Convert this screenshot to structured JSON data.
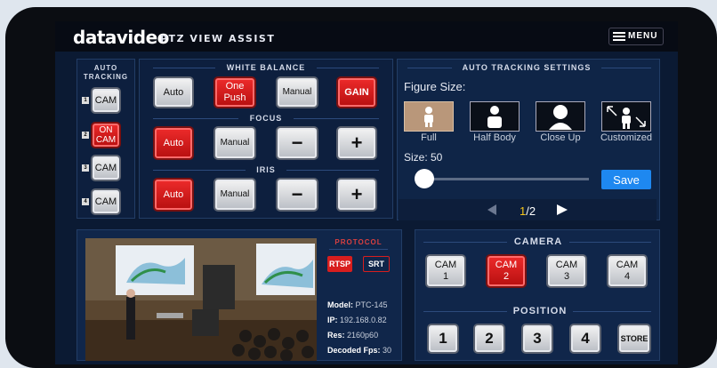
{
  "header": {
    "brand": "datavideo",
    "title": "PTZ VIEW ASSIST",
    "menu_label": "MENU"
  },
  "auto_tracking": {
    "title_line1": "AUTO",
    "title_line2": "TRACKING",
    "cams": [
      {
        "num": "1",
        "label": "CAM",
        "state": "off"
      },
      {
        "num": "2",
        "label_line1": "ON",
        "label_line2": "CAM",
        "state": "on"
      },
      {
        "num": "3",
        "label": "CAM",
        "state": "off"
      },
      {
        "num": "4",
        "label": "CAM",
        "state": "off"
      }
    ]
  },
  "white_balance": {
    "title": "WHITE BALANCE",
    "auto": "Auto",
    "one_push_line1": "One",
    "one_push_line2": "Push",
    "manual": "Manual",
    "gain": "GAIN"
  },
  "focus": {
    "title": "FOCUS",
    "auto": "Auto",
    "manual": "Manual",
    "minus": "−",
    "plus": "+"
  },
  "iris": {
    "title": "IRIS",
    "auto": "Auto",
    "manual": "Manual",
    "minus": "−",
    "plus": "+"
  },
  "tracking_settings": {
    "title": "AUTO TRACKING SETTINGS",
    "figure_size_label": "Figure Size:",
    "options": [
      "Full",
      "Half Body",
      "Close Up",
      "Customized"
    ],
    "selected_option": "Full",
    "size_label": "Size: 50",
    "size_value": 50,
    "save": "Save",
    "page_current": "1",
    "page_total": "/2"
  },
  "protocol": {
    "title": "PROTOCOL",
    "rtsp": "RTSP",
    "srt": "SRT",
    "active": "RTSP"
  },
  "stream_info": {
    "model_label": "Model:",
    "model": "PTC-145",
    "ip_label": "IP:",
    "ip": "192.168.0.82",
    "res_label": "Res:",
    "res": "2160p60",
    "fps_label": "Decoded Fps:",
    "fps": "30"
  },
  "camera": {
    "title": "CAMERA",
    "buttons": [
      {
        "line1": "CAM",
        "line2": "1",
        "state": "off"
      },
      {
        "line1": "CAM",
        "line2": "2",
        "state": "on"
      },
      {
        "line1": "CAM",
        "line2": "3",
        "state": "off"
      },
      {
        "line1": "CAM",
        "line2": "4",
        "state": "off"
      }
    ]
  },
  "position": {
    "title": "POSITION",
    "buttons": [
      "1",
      "2",
      "3",
      "4",
      "STORE"
    ]
  },
  "colors": {
    "active_red": "#d81e1e",
    "save_blue": "#1e88f0",
    "panel_bg": "#10264a",
    "page_accent": "#f5c518"
  }
}
